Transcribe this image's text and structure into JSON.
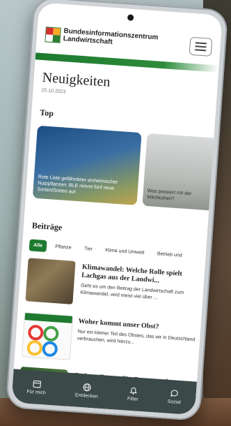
{
  "header": {
    "logo_line1": "Bundesinformationszentrum",
    "logo_line2": "Landwirtschaft"
  },
  "page": {
    "title": "Neuigkeiten",
    "date": "25.10.2023"
  },
  "sections": {
    "top": "Top",
    "posts": "Beiträge"
  },
  "top_cards": [
    {
      "caption": "Rote Liste gefährdeter einheimischer Nutzpflanzen: BLE nimmt fünf neue Sorten/Sorten auf"
    },
    {
      "caption": "Was passiert mit der Milchkühen?"
    }
  ],
  "tabs": [
    "Alle",
    "Pflanze",
    "Tier",
    "Klima und Umwelt",
    "Betrieb und"
  ],
  "articles": [
    {
      "title": "Klimawandel: Welche Rolle spielt Lachgas aus der Landwi...",
      "text": "Geht es um den Beitrag der Landwirtschaft zum Klimawandel, wird meist viel über ..."
    },
    {
      "title": "Woher kommt unser Obst?",
      "text": "Nur ein kleiner Teil des Obstes, das wir in Deutschland verbrauchen, wird hierzu..."
    },
    {
      "title": "Essbare Exoten für Garten und",
      "text": ""
    }
  ],
  "bottom_nav": [
    {
      "label": "Für mich",
      "icon": "calendar-icon"
    },
    {
      "label": "Entdecken",
      "icon": "globe-icon"
    },
    {
      "label": "Filter",
      "icon": "bell-icon"
    },
    {
      "label": "Sozial",
      "icon": "chat-icon"
    }
  ],
  "colors": {
    "accent_green": "#1e7a2f",
    "nav_bg": "#3b4948"
  }
}
